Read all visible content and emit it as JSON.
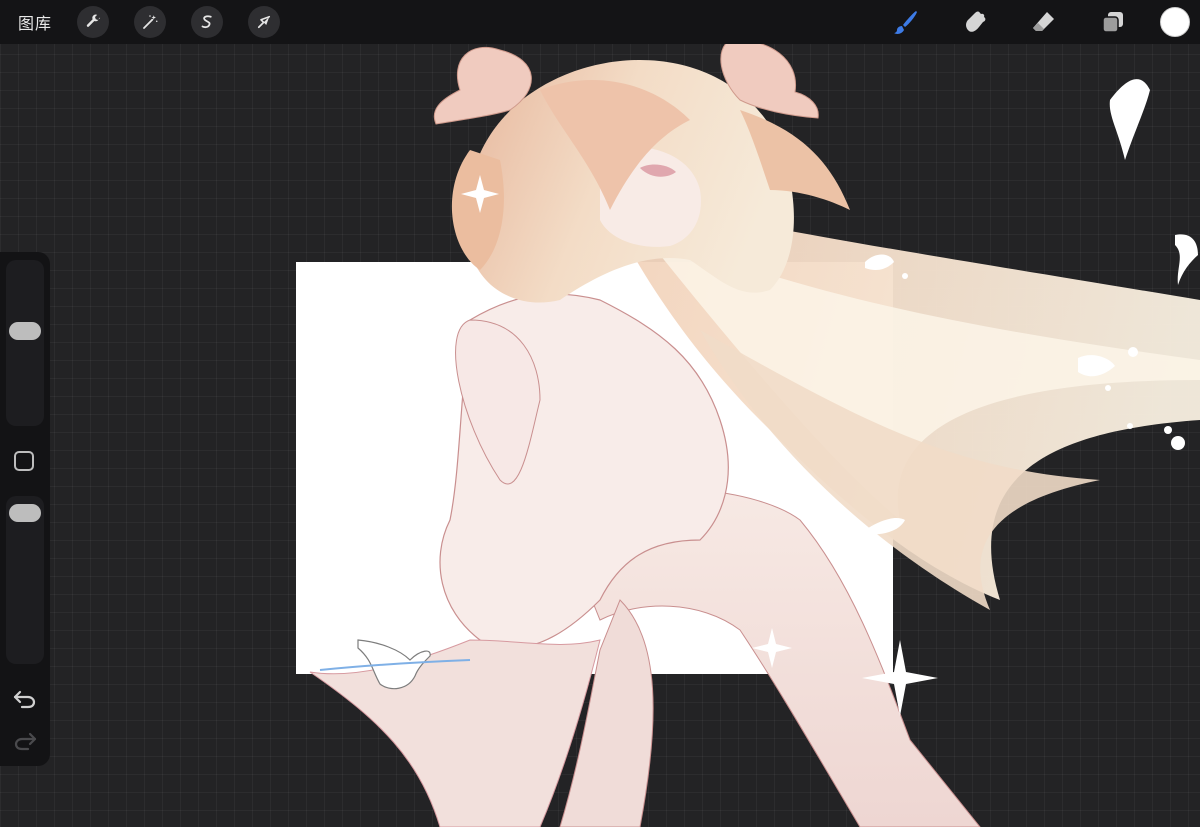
{
  "topbar": {
    "gallery_label": "图库",
    "left_tools": [
      {
        "name": "actions",
        "icon": "wrench-icon"
      },
      {
        "name": "adjustments",
        "icon": "magic-wand-icon"
      },
      {
        "name": "selection",
        "icon": "selection-s-icon"
      },
      {
        "name": "transform",
        "icon": "arrow-cursor-icon"
      }
    ],
    "right_tools": [
      {
        "name": "brush",
        "icon": "paintbrush-icon",
        "active": true
      },
      {
        "name": "smudge",
        "icon": "smudge-finger-icon",
        "active": false
      },
      {
        "name": "eraser",
        "icon": "eraser-icon",
        "active": false
      },
      {
        "name": "layers",
        "icon": "layers-icon",
        "active": false
      }
    ],
    "current_color": "#ffffff"
  },
  "sidebar": {
    "brush_size_level": 0.58,
    "opacity_level": 0.95,
    "modify_icon": "square-icon",
    "undo_icon": "undo-arrow-icon",
    "redo_icon": "redo-arrow-icon"
  },
  "colors": {
    "accent_brush": "#3d7be6",
    "toolbar_bg": "#141416",
    "canvas_bg": "#232325"
  }
}
